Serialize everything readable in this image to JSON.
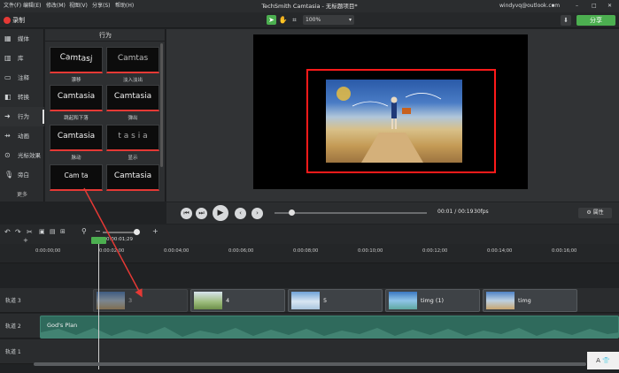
{
  "menu": [
    "文件(F)",
    "编辑(E)",
    "修改(M)",
    "视图(V)",
    "分享(S)",
    "帮助(H)"
  ],
  "window_title": "TechSmith Camtasia - 无标题项目*",
  "account": "windyvq@outlook.com",
  "toolbar": {
    "record_label": "录制",
    "zoom_value": "100%",
    "share_label": "分享"
  },
  "sidebar": {
    "items": [
      {
        "label": "媒体",
        "icon": "media-icon"
      },
      {
        "label": "库",
        "icon": "library-icon"
      },
      {
        "label": "注释",
        "icon": "annotation-icon"
      },
      {
        "label": "转换",
        "icon": "transition-icon"
      },
      {
        "label": "行为",
        "icon": "behavior-icon"
      },
      {
        "label": "动画",
        "icon": "animation-icon"
      },
      {
        "label": "光标效果",
        "icon": "cursor-effect-icon"
      },
      {
        "label": "旁白",
        "icon": "voice-narration-icon"
      }
    ],
    "more_label": "更多"
  },
  "panel": {
    "title": "行为",
    "tiles": [
      {
        "thumb": "Camtasj",
        "caption": "漂移"
      },
      {
        "thumb": "Camtas",
        "caption": "淡入淡出"
      },
      {
        "thumb": "Camtasia",
        "caption": "跳起和下落"
      },
      {
        "thumb": "Camtasia",
        "caption": "弹出"
      },
      {
        "thumb": "Camtasia",
        "caption": "脉动"
      },
      {
        "thumb": "t a s i a",
        "caption": "显示"
      },
      {
        "thumb": "Cam ta",
        "caption": ""
      },
      {
        "thumb": "Camtasia",
        "caption": ""
      }
    ]
  },
  "player": {
    "timecode": "00:01 / 00:19",
    "fps": "30fps",
    "properties_label": "属性"
  },
  "timeline": {
    "playhead_time": "0:00:01;29",
    "ticks": [
      "0:00:00;00",
      "0:00:02;00",
      "0:00:04;00",
      "0:00:06;00",
      "0:00:08;00",
      "0:00:10;00",
      "0:00:12;00",
      "0:00:14;00",
      "0:00:16;00"
    ],
    "tracks": [
      {
        "label": "轨道 3"
      },
      {
        "label": "轨道 2"
      },
      {
        "label": "轨道 1"
      }
    ],
    "clips": [
      {
        "name": "3"
      },
      {
        "name": "4"
      },
      {
        "name": "5"
      },
      {
        "name": "timg (1)"
      },
      {
        "name": "timg"
      }
    ],
    "audio_clip": "God's Plan"
  },
  "colors": {
    "accent_green": "#4caf50",
    "record_red": "#e53935",
    "highlight_red": "#ff1a1a"
  }
}
